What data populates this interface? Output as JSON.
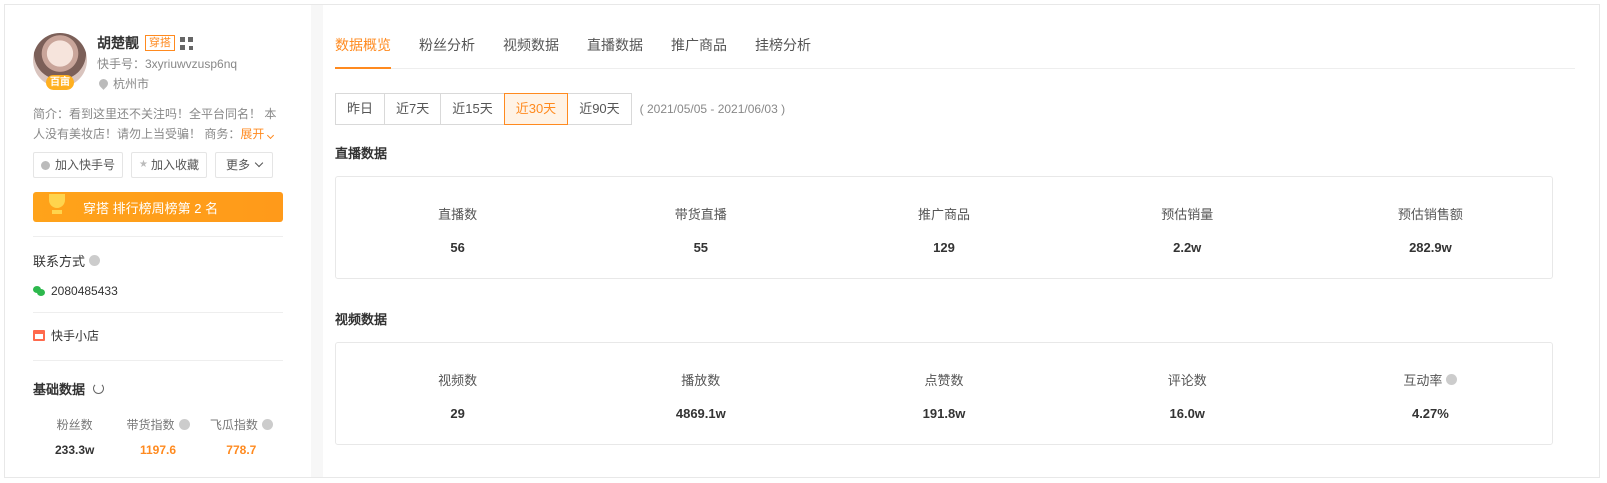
{
  "profile": {
    "name": "胡楚靓",
    "tag": "穿搭",
    "avatar_badge": "百亩",
    "kuaishou_id": "快手号：3xyriuwvzusp6nq",
    "location": "杭州市",
    "intro": "简介：看到这里还不关注吗！全平台同名！ 本人没有美妆店！请勿上当受骗！ 商务：",
    "expand": "展开"
  },
  "actions": {
    "add_kuaishou": "加入快手号",
    "add_favorite": "加入收藏",
    "more": "更多"
  },
  "rank": {
    "text": "穿搭 排行榜周榜第 2 名"
  },
  "contact": {
    "label": "联系方式",
    "wechat": "2080485433"
  },
  "shop": {
    "label": "快手小店"
  },
  "basic": {
    "title": "基础数据",
    "items": [
      {
        "label": "粉丝数",
        "value": "233.3w"
      },
      {
        "label": "带货指数",
        "value": "1197.6"
      },
      {
        "label": "飞瓜指数",
        "value": "778.7"
      }
    ]
  },
  "tabs": [
    "数据概览",
    "粉丝分析",
    "视频数据",
    "直播数据",
    "推广商品",
    "挂榜分析"
  ],
  "ranges": [
    "昨日",
    "近7天",
    "近15天",
    "近30天",
    "近90天"
  ],
  "date_range": "( 2021/05/05 - 2021/06/03 )",
  "live": {
    "title": "直播数据",
    "stats": [
      {
        "label": "直播数",
        "value": "56"
      },
      {
        "label": "带货直播",
        "value": "55"
      },
      {
        "label": "推广商品",
        "value": "129"
      },
      {
        "label": "预估销量",
        "value": "2.2w"
      },
      {
        "label": "预估销售额",
        "value": "282.9w"
      }
    ]
  },
  "video": {
    "title": "视频数据",
    "stats": [
      {
        "label": "视频数",
        "value": "29"
      },
      {
        "label": "播放数",
        "value": "4869.1w"
      },
      {
        "label": "点赞数",
        "value": "191.8w"
      },
      {
        "label": "评论数",
        "value": "16.0w"
      },
      {
        "label": "互动率",
        "value": "4.27%"
      }
    ]
  },
  "colors": {
    "accent": "#ff8a1f",
    "rank_bar": "#ffa31a",
    "wechat": "#2db84d"
  }
}
